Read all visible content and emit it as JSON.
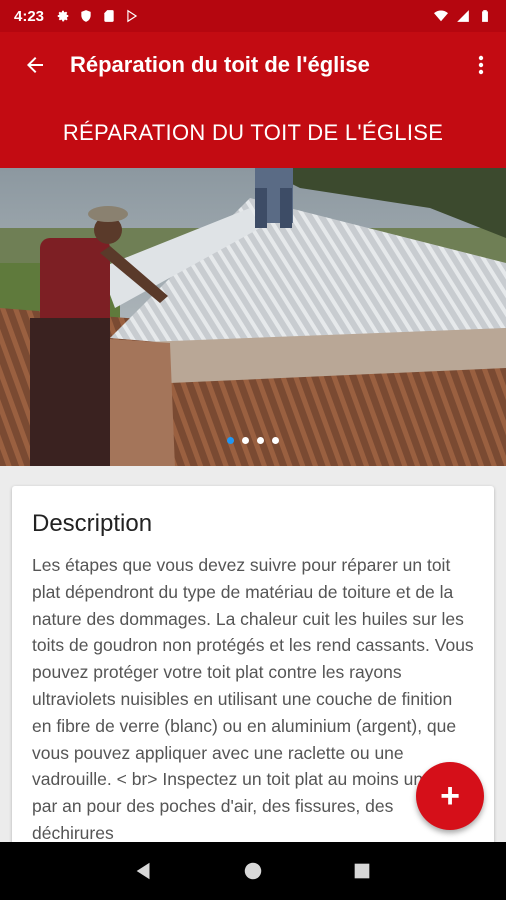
{
  "status_bar": {
    "time": "4:23",
    "icons_left": [
      "settings-icon",
      "shield-icon",
      "sd-card-icon",
      "play-store-icon"
    ],
    "icons_right": [
      "wifi-icon",
      "signal-icon",
      "battery-icon"
    ]
  },
  "app_bar": {
    "title": "Réparation du toit de l'église",
    "back_icon": "arrow-back-icon",
    "menu_icon": "more-vert-icon"
  },
  "banner": {
    "text": "RÉPARATION DU TOIT DE L'ÉGLISE"
  },
  "carousel": {
    "image": "church-roof-repair-photo",
    "slide_count": 4,
    "active_index": 0
  },
  "description": {
    "title": "Description",
    "body": "Les étapes que vous devez suivre pour réparer un toit plat dépendront du type de matériau de toiture et de la nature des dommages.  La chaleur cuit les huiles sur les toits de goudron non protégés et les rend cassants. Vous pouvez protéger votre toit plat contre les rayons ultraviolets nuisibles en utilisant une couche de finition en fibre de verre (blanc) ou en aluminium (argent), que vous pouvez appliquer avec une raclette ou une vadrouille. < br> Inspectez un toit plat au moins une fois par an pour des poches d'air, des fissures, des déchirures"
  },
  "fab": {
    "label": "+"
  },
  "colors": {
    "primary": "#c30b12",
    "status_bar": "#b5060f",
    "fab": "#d50f19",
    "accent_dot": "#2196f3"
  }
}
